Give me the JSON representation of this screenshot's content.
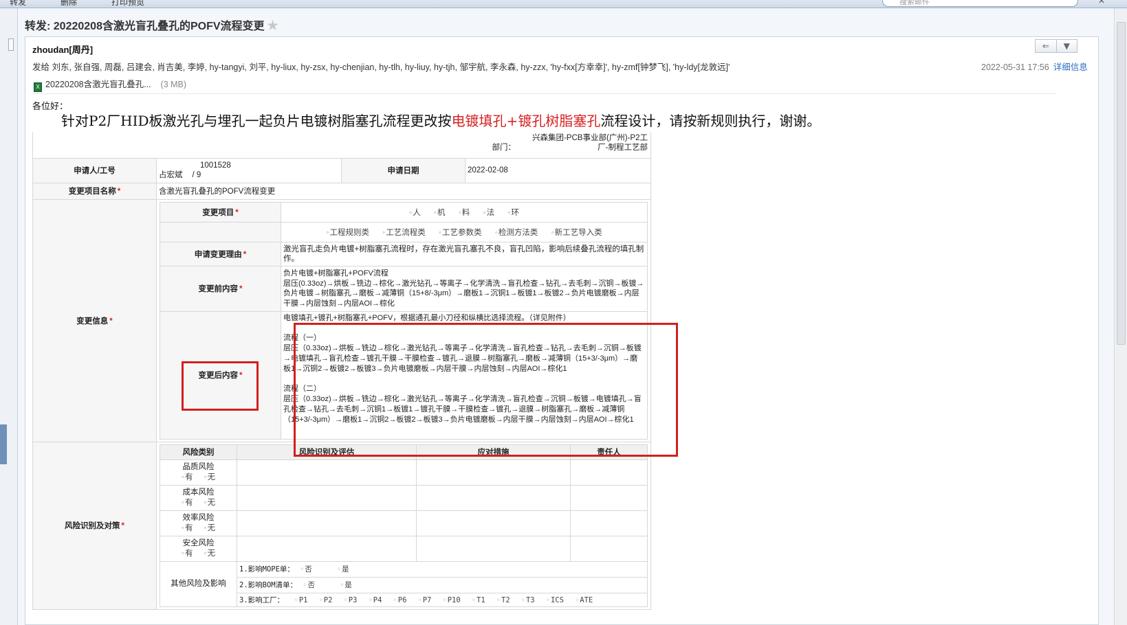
{
  "toolbar": {
    "reply_label": "转发",
    "delete_label": "删除",
    "print_label": "打印预览",
    "search_placeholder": "搜索邮件"
  },
  "header": {
    "subject": "转发: 20220208含激光盲孔叠孔的POFV流程变更",
    "star_icon": "star-icon",
    "sender": "zhoudan[周丹]",
    "recipients_label": "发给",
    "recipients": "刘东, 张自强, 周磊, 吕建会, 肖吉美, 李婷, hy-tangyi, 刘平, hy-liux, hy-zsx, hy-chenjian, hy-tlh, hy-liuy, hy-tjh, 邹宇航, 李永森, hy-zzx, 'hy-fxx[方幸幸]', hy-zmf[钟梦飞], 'hy-ldy[龙敦远]'",
    "date": "2022-05-31 17:56",
    "detail_link": "详细信息",
    "attachment_name": "20220208含激光盲孔叠孔...",
    "attachment_size": "(3 MB)"
  },
  "body": {
    "greeting": "各位好：",
    "line_part1": "针对P2厂HID板激光孔与埋孔一起负片电镀树脂塞孔流程更改按",
    "line_red": "电镀填孔+镀孔树脂塞孔",
    "line_part2": "流程设计，请按新规则执行，谢谢。"
  },
  "form": {
    "dept_label": "部门：",
    "dept_value": "兴森集团-PCB事业部(广州)-P2工厂-制程工艺部",
    "applicant_label": "申请人/工号",
    "applicant_id": "1001528",
    "applicant_name": "占宏斌",
    "applicant_slash": "/ 9",
    "date_label": "申请日期",
    "date_value": "2022-02-08",
    "project_label": "变更项目名称",
    "project_value": "含激光盲孔叠孔的POFV流程变更",
    "info_label": "变更信息",
    "item_label": "变更项目",
    "items_row1": [
      "人",
      "机",
      "料",
      "法",
      "环"
    ],
    "items_row2": [
      "工程规则类",
      "工艺流程类",
      "工艺参数类",
      "检测方法类",
      "新工艺导入类"
    ],
    "reason_label": "申请变更理由",
    "reason_value": "激光盲孔走负片电镀+树脂塞孔流程时，存在激光盲孔塞孔不良，盲孔凹陷，影响后续叠孔流程的填孔制作。",
    "before_label": "变更前内容",
    "before_lines": [
      "负片电镀+树脂塞孔+POFV流程",
      "层压(0.33oz)→烘板→铣边→棕化→激光钻孔→等离子→化学清洗→盲孔检查→钻孔→去毛刺→沉铜→板镀→负片电镀→树脂塞孔→磨板→减薄铜（15+8/-3μm）→磨板1→沉铜1→板镀1→板镀2→负片电镀磨板→内层干膜→内层蚀刻→内层AOI→棕化"
    ],
    "after_label": "变更后内容",
    "after_lines": [
      "电镀填孔+镀孔+树脂塞孔+POFV，根据通孔最小刀径和纵横比选择流程。（详见附件）",
      "",
      "流程（一）",
      "层压（0.33oz)→烘板→铣边→棕化→激光钻孔→等离子→化学清洗→盲孔检查→钻孔→去毛刺→沉铜→板镀→电镀填孔→盲孔检查→镀孔干膜→干膜检查→镀孔→退膜→树脂塞孔→磨板→减薄铜（15+3/-3μm）→磨板1→沉铜2→板镀2→板镀3→负片电镀磨板→内层干膜→内层蚀刻→内层AOI→棕化1",
      "",
      "流程（二）",
      "层压（0.33oz)→烘板→铣边→棕化→激光钻孔→等离子→化学清洗→盲孔检查→沉铜→板镀→电镀填孔→盲孔检查→钻孔→去毛刺→沉铜1→板镀1→镀孔干膜→干膜检查→镀孔→退膜→树脂塞孔→磨板→减薄铜（15+3/-3μm）→磨板1→沉铜2→板镀2→板镀3→负片电镀磨板→内层干膜→内层蚀刻→内层AOI→棕化1"
    ],
    "risk_label": "风险识别及对策",
    "risk_headers": [
      "风险类别",
      "风险识别及评估",
      "应对措施",
      "责任人"
    ],
    "risk_rows": [
      {
        "category": "品质风险",
        "yes": "有",
        "no": "无"
      },
      {
        "category": "成本风险",
        "yes": "有",
        "no": "无"
      },
      {
        "category": "效率风险",
        "yes": "有",
        "no": "无"
      },
      {
        "category": "安全风险",
        "yes": "有",
        "no": "无"
      }
    ],
    "other_label": "其他风险及影响",
    "other_lines": [
      {
        "text": "1.影响MOPE单：",
        "a": "否",
        "b": "是"
      },
      {
        "text": "2.影响BOM清单：",
        "a": "否",
        "b": "是"
      }
    ],
    "factory_line_label": "3.影响工厂：",
    "factories": [
      "P1",
      "P2",
      "P3",
      "P4",
      "P6",
      "P7",
      "P10",
      "T1",
      "T2",
      "T3",
      "ICS",
      "ATE"
    ]
  }
}
